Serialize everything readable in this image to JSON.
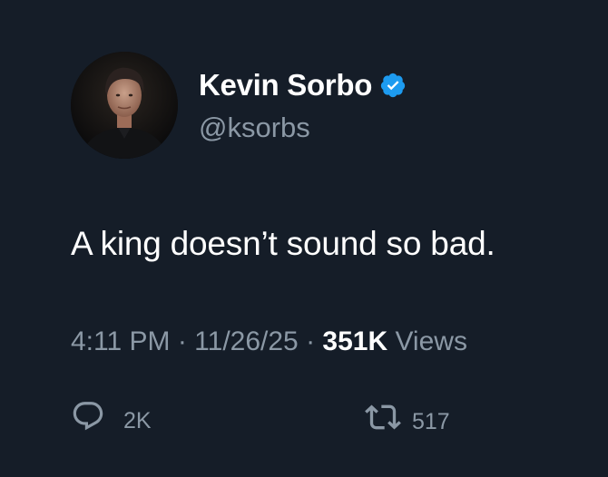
{
  "author": {
    "display_name": "Kevin Sorbo",
    "handle": "@ksorbs",
    "verified": true,
    "verified_color": "#1d9bf0"
  },
  "tweet": {
    "text": "A king doesn’t sound so bad."
  },
  "meta": {
    "time": "4:11 PM",
    "separator": "·",
    "date": "11/26/25",
    "views_count": "351K",
    "views_label": "Views"
  },
  "actions": {
    "reply": {
      "icon": "reply-icon",
      "count": "2K"
    },
    "repost": {
      "icon": "repost-icon",
      "count": "517"
    }
  },
  "colors": {
    "background": "#151d28",
    "text_primary": "#ffffff",
    "text_secondary": "#8b98a5"
  }
}
